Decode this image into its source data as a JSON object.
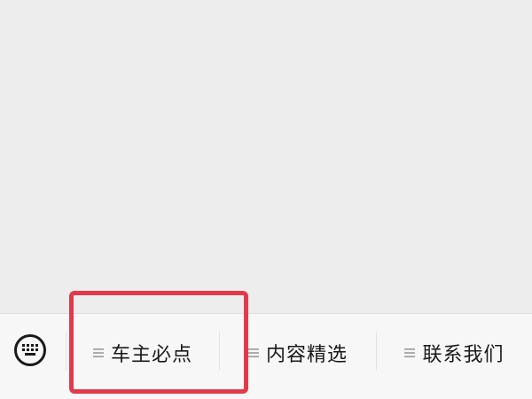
{
  "menu": {
    "items": [
      {
        "label": "车主必点",
        "icon": "menu-lines-icon"
      },
      {
        "label": "内容精选",
        "icon": "menu-lines-icon"
      },
      {
        "label": "联系我们",
        "icon": "menu-lines-icon"
      }
    ],
    "keyboard_icon": "keyboard-icon"
  },
  "colors": {
    "chat_background": "#ededed",
    "menu_background": "#f7f7f7",
    "highlight": "#e23a4b",
    "text": "#1a1a1a",
    "lines_icon": "#9a9a9a"
  }
}
